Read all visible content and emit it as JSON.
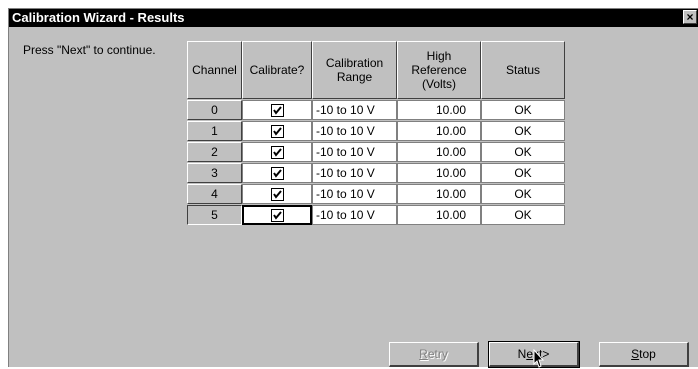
{
  "window": {
    "title": "Calibration Wizard - Results",
    "close_glyph": "×"
  },
  "prompt": "Press \"Next\" to continue.",
  "table": {
    "headers": [
      "Channel",
      "Calibrate?",
      "Calibration Range",
      "High Reference (Volts)",
      "Status"
    ],
    "header_lines": {
      "range": [
        "Calibration",
        "Range"
      ],
      "ref": [
        "High",
        "Reference",
        "(Volts)"
      ]
    },
    "rows": [
      {
        "channel": "0",
        "calibrate": true,
        "range": "-10 to 10 V",
        "ref": "10.00",
        "status": "OK"
      },
      {
        "channel": "1",
        "calibrate": true,
        "range": "-10 to 10 V",
        "ref": "10.00",
        "status": "OK"
      },
      {
        "channel": "2",
        "calibrate": true,
        "range": "-10 to 10 V",
        "ref": "10.00",
        "status": "OK"
      },
      {
        "channel": "3",
        "calibrate": true,
        "range": "-10 to 10 V",
        "ref": "10.00",
        "status": "OK"
      },
      {
        "channel": "4",
        "calibrate": true,
        "range": "-10 to 10 V",
        "ref": "10.00",
        "status": "OK"
      },
      {
        "channel": "5",
        "calibrate": true,
        "range": "-10 to 10 V",
        "ref": "10.00",
        "status": "OK"
      }
    ]
  },
  "buttons": {
    "retry": {
      "mnemonic": "R",
      "rest": "etry",
      "enabled": false
    },
    "next": {
      "pre": "N",
      "mnemonic": "e",
      "rest": "xt>",
      "enabled": true
    },
    "stop": {
      "mnemonic": "S",
      "rest": "top",
      "enabled": true
    }
  }
}
